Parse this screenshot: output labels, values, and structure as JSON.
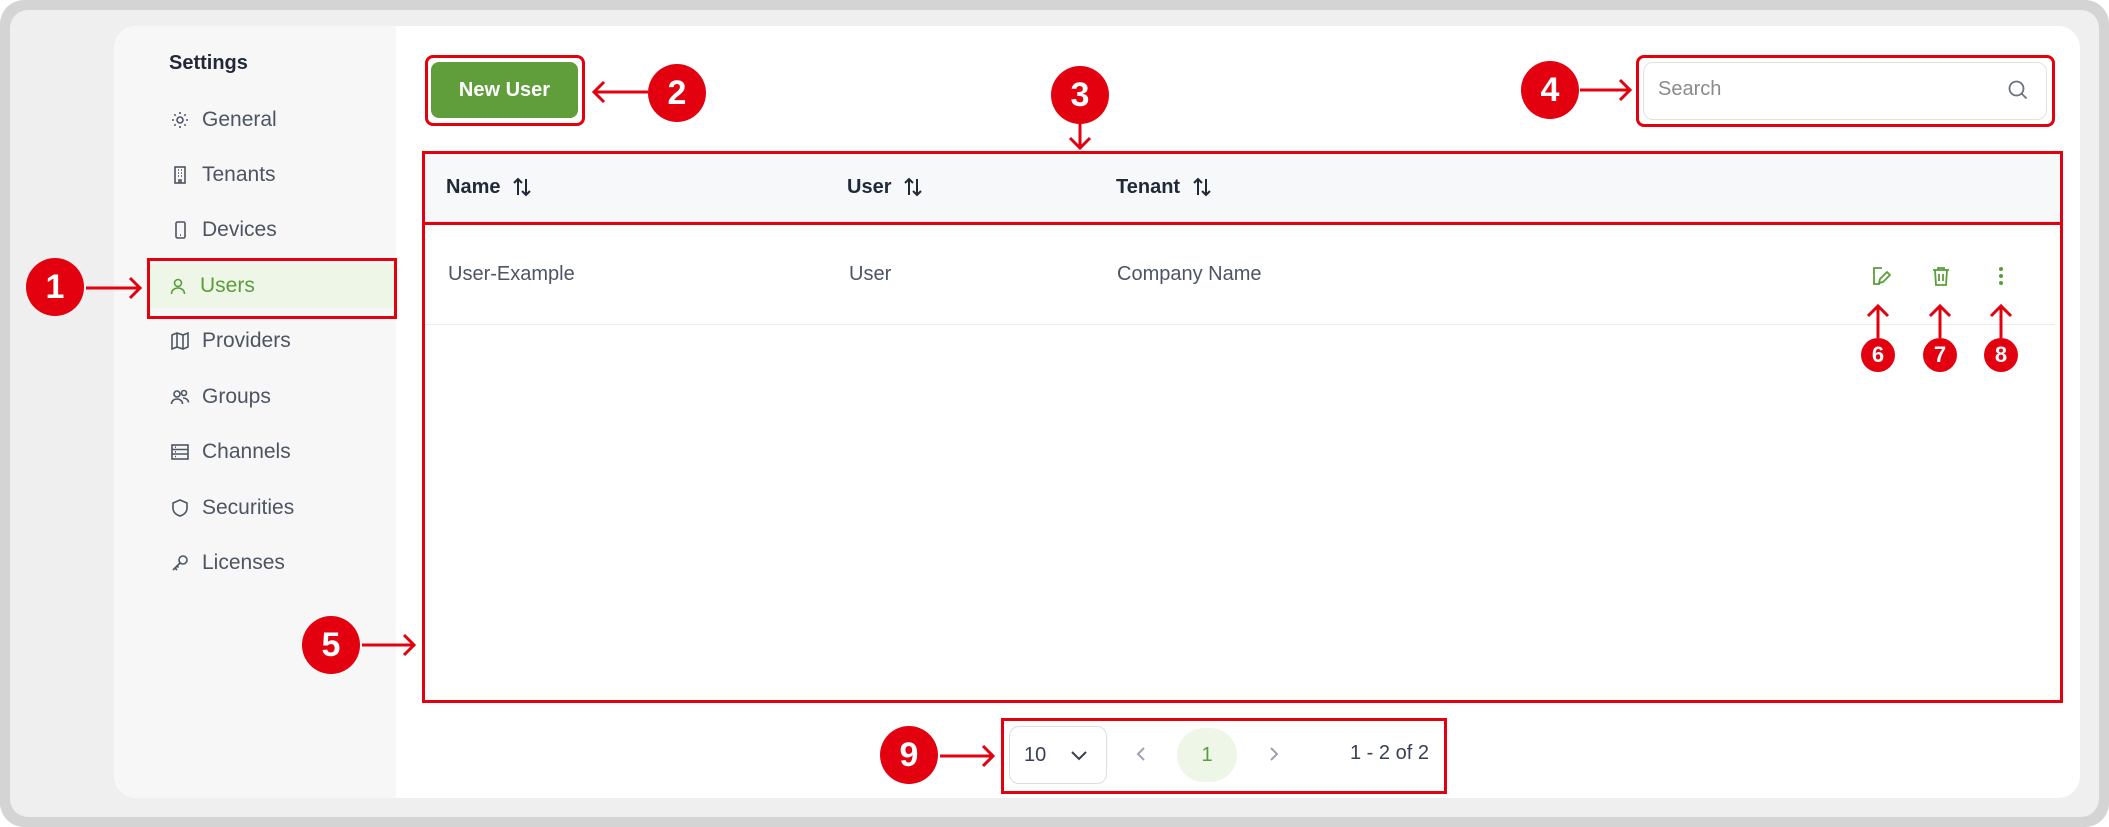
{
  "sidebar": {
    "title": "Settings",
    "items": [
      {
        "label": "General",
        "icon": "gear-icon"
      },
      {
        "label": "Tenants",
        "icon": "building-icon"
      },
      {
        "label": "Devices",
        "icon": "phone-icon"
      },
      {
        "label": "Users",
        "icon": "user-icon",
        "active": true
      },
      {
        "label": "Providers",
        "icon": "map-icon"
      },
      {
        "label": "Groups",
        "icon": "users-icon"
      },
      {
        "label": "Channels",
        "icon": "server-icon"
      },
      {
        "label": "Securities",
        "icon": "shield-icon"
      },
      {
        "label": "Licenses",
        "icon": "key-icon"
      }
    ]
  },
  "toolbar": {
    "new_user_label": "New User"
  },
  "search": {
    "placeholder": "Search"
  },
  "table": {
    "columns": [
      "Name",
      "User",
      "Tenant"
    ],
    "rows": [
      {
        "name": "User-Example",
        "user": "User",
        "tenant": "Company Name"
      }
    ]
  },
  "pagination": {
    "page_size": "10",
    "current_page": "1",
    "range_label": "1 - 2 of 2"
  },
  "annotations": [
    "1",
    "2",
    "3",
    "4",
    "5",
    "6",
    "7",
    "8",
    "9"
  ],
  "colors": {
    "accent": "#5f9e3b",
    "annotation": "#e3000f",
    "active_bg": "#eef6e8"
  }
}
